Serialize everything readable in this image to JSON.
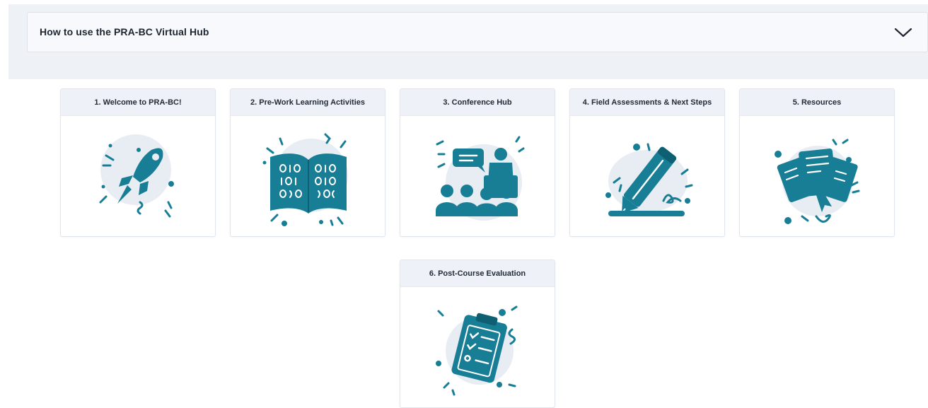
{
  "accordion": {
    "title": "How to use the PRA-BC Virtual Hub",
    "chevron_icon": "chevron-down-icon"
  },
  "colors": {
    "accent": "#177e96",
    "blob": "#e8ecf3",
    "band": "#eef2f7",
    "tile_header": "#eef1f7"
  },
  "tiles": [
    {
      "label": "1. Welcome to PRA-BC!",
      "icon": "rocket-icon"
    },
    {
      "label": "2. Pre-Work Learning Activities",
      "icon": "open-book-icon"
    },
    {
      "label": "3. Conference Hub",
      "icon": "conference-audience-icon"
    },
    {
      "label": "4. Field Assessments & Next Steps",
      "icon": "pencil-icon"
    },
    {
      "label": "5. Resources",
      "icon": "documents-icon"
    },
    {
      "label": "6. Post-Course Evaluation",
      "icon": "clipboard-checklist-icon"
    }
  ]
}
